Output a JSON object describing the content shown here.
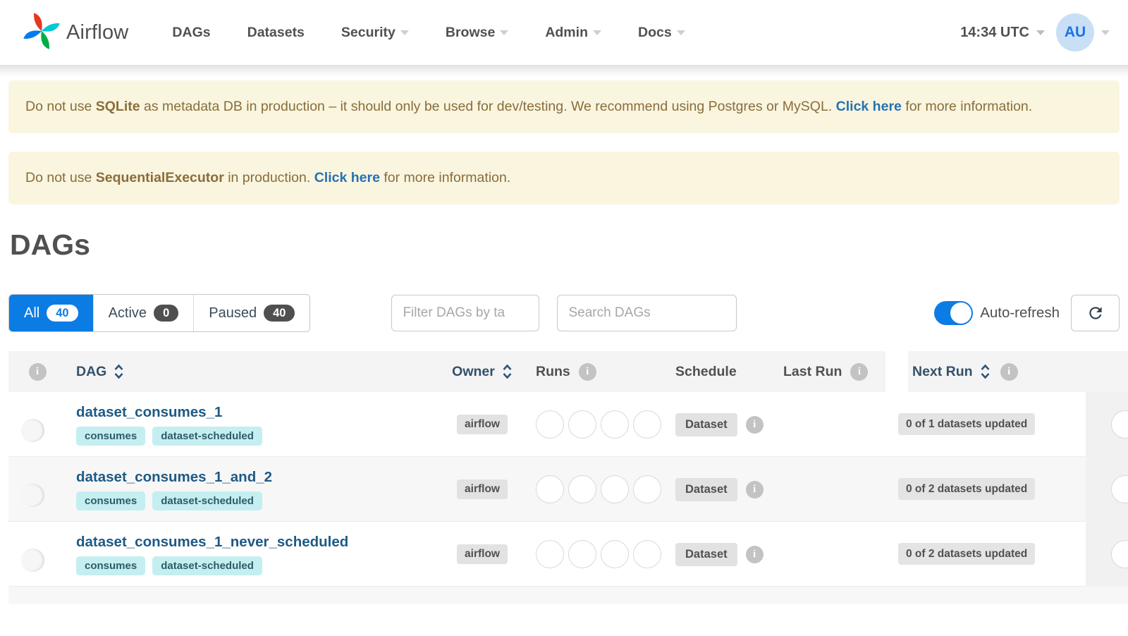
{
  "colors": {
    "brand_blue": "#0b7ce4",
    "warning_bg": "#f9f5df",
    "warning_text": "#8a6d3b",
    "link_blue": "#2572b2",
    "tag_bg": "#c5eef1",
    "tag_text": "#2b5d68",
    "avatar_bg": "#c9dff5",
    "avatar_text": "#1a73e8"
  },
  "icons": {
    "info_glyph": "i"
  },
  "navbar": {
    "brand": "Airflow",
    "items": [
      {
        "label": "DAGs",
        "has_caret": false
      },
      {
        "label": "Datasets",
        "has_caret": false
      },
      {
        "label": "Security",
        "has_caret": true
      },
      {
        "label": "Browse",
        "has_caret": true
      },
      {
        "label": "Admin",
        "has_caret": true
      },
      {
        "label": "Docs",
        "has_caret": true
      }
    ],
    "clock": "14:34 UTC",
    "avatar_initials": "AU"
  },
  "banners": [
    {
      "prefix": "Do not use ",
      "bold": "SQLite",
      "middle": " as metadata DB in production – it should only be used for dev/testing. We recommend using Postgres or MySQL. ",
      "link": "Click here",
      "suffix": " for more information."
    },
    {
      "prefix": "Do not use ",
      "bold": "SequentialExecutor",
      "middle": " in production. ",
      "link": "Click here",
      "suffix": " for more information."
    }
  ],
  "page_title": "DAGs",
  "filters": {
    "tabs": [
      {
        "label": "All",
        "count": "40",
        "active": true
      },
      {
        "label": "Active",
        "count": "0",
        "active": false
      },
      {
        "label": "Paused",
        "count": "40",
        "active": false
      }
    ],
    "tag_filter_placeholder": "Filter DAGs by ta",
    "search_placeholder": "Search DAGs",
    "auto_refresh_label": "Auto-refresh"
  },
  "table": {
    "headers": {
      "dag": "DAG",
      "owner": "Owner",
      "runs": "Runs",
      "schedule": "Schedule",
      "last_run": "Last Run",
      "next_run": "Next Run"
    },
    "rows": [
      {
        "name": "dataset_consumes_1",
        "tags": [
          "consumes",
          "dataset-scheduled"
        ],
        "owner": "airflow",
        "schedule": "Dataset",
        "next_run": "0 of 1 datasets updated"
      },
      {
        "name": "dataset_consumes_1_and_2",
        "tags": [
          "consumes",
          "dataset-scheduled"
        ],
        "owner": "airflow",
        "schedule": "Dataset",
        "next_run": "0 of 2 datasets updated"
      },
      {
        "name": "dataset_consumes_1_never_scheduled",
        "tags": [
          "consumes",
          "dataset-scheduled"
        ],
        "owner": "airflow",
        "schedule": "Dataset",
        "next_run": "0 of 2 datasets updated"
      }
    ]
  }
}
